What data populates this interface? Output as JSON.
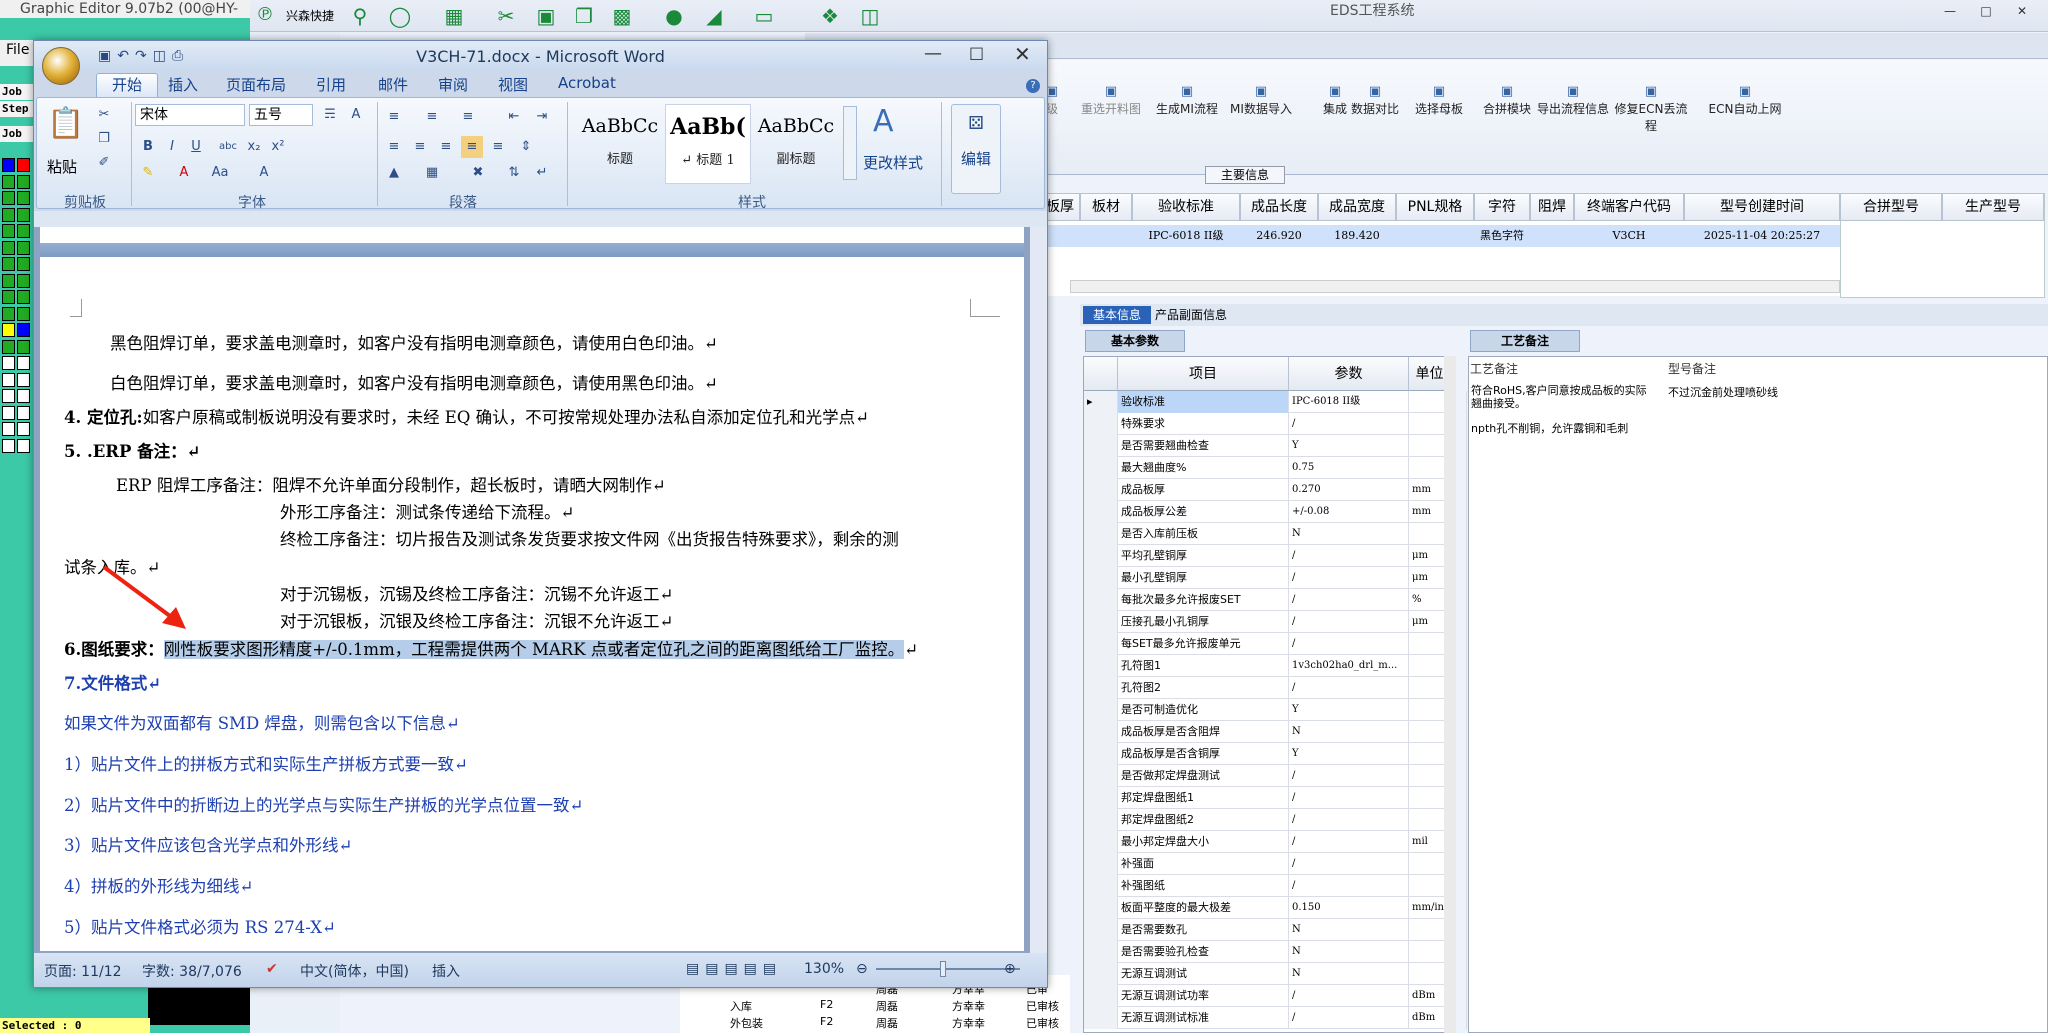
{
  "graphic_editor": {
    "title": "Graphic Editor 9.07b2 (00@HY-",
    "menu": "File",
    "labels": [
      "Job",
      "Step",
      "Job"
    ],
    "status": "Selected : 0"
  },
  "eds": {
    "title": "EDS工程系统",
    "quick_label": "兴森快捷",
    "toolbar_icons": [
      "search-icon",
      "lifebuoy-icon",
      "table-icon",
      "scissors-icon",
      "film-icon",
      "copy-icon",
      "grid-icon",
      "user-icon",
      "chart-icon",
      "monitor-icon",
      "windows-icon",
      "book-icon"
    ],
    "ribbon": [
      "级",
      "重选开料图",
      "生成MI流程",
      "MI数据导入",
      "集成",
      "数据对比",
      "选择母板",
      "合拼模块",
      "导出流程信息",
      "修复ECN丢流程",
      "ECN自动上网"
    ],
    "main_info_label": "主要信息",
    "grid_headers": [
      "板厚",
      "板材",
      "验收标准",
      "成品长度",
      "成品宽度",
      "PNL规格",
      "字符",
      "阻焊",
      "终端客户代码",
      "型号创建时间"
    ],
    "grid_row": [
      "",
      "",
      "IPC-6018 II级",
      "246.920",
      "189.420",
      "",
      "黑色字符",
      "",
      "V3CH",
      "2025-11-04 20:25:27"
    ],
    "side_headers": [
      "合拼型号",
      "生产型号"
    ],
    "tabs": {
      "basic": "基本信息",
      "product": "产品副面信息"
    },
    "sub_tabs": {
      "basic_params": "基本参数",
      "process_notes": "工艺备注"
    },
    "param_headers": [
      "项目",
      "参数",
      "单位"
    ],
    "params": [
      [
        "验收标准",
        "IPC-6018 II级",
        ""
      ],
      [
        "特殊要求",
        "/",
        ""
      ],
      [
        "是否需要翘曲检查",
        "Y",
        ""
      ],
      [
        "最大翘曲度%",
        "0.75",
        ""
      ],
      [
        "成品板厚",
        "0.270",
        "mm"
      ],
      [
        "成品板厚公差",
        "+/-0.08",
        "mm"
      ],
      [
        "是否入库前压板",
        "N",
        ""
      ],
      [
        "平均孔壁铜厚",
        "/",
        "μm"
      ],
      [
        "最小孔壁铜厚",
        "/",
        "μm"
      ],
      [
        "每批次最多允许报废SET",
        "/",
        "%"
      ],
      [
        "压接孔最小孔铜厚",
        "/",
        "μm"
      ],
      [
        "每SET最多允许报废单元",
        "/",
        ""
      ],
      [
        "孔符图1",
        "1v3ch02ha0_drl_m...",
        ""
      ],
      [
        "孔符图2",
        "/",
        ""
      ],
      [
        "是否可制造优化",
        "Y",
        ""
      ],
      [
        "成品板厚是否含阻焊",
        "N",
        ""
      ],
      [
        "成品板厚是否含铜厚",
        "Y",
        ""
      ],
      [
        "是否做邦定焊盘测试",
        "/",
        ""
      ],
      [
        "邦定焊盘图纸1",
        "/",
        ""
      ],
      [
        "邦定焊盘图纸2",
        "/",
        ""
      ],
      [
        "最小邦定焊盘大小",
        "/",
        "mil"
      ],
      [
        "补强面",
        "/",
        ""
      ],
      [
        "补强图纸",
        "/",
        ""
      ],
      [
        "板面平整度的最大极差",
        "0.150",
        "mm/inch"
      ],
      [
        "是否需要数孔",
        "N",
        ""
      ],
      [
        "是否需要验孔检查",
        "N",
        ""
      ],
      [
        "无源互调测试",
        "N",
        ""
      ],
      [
        "无源互调测试功率",
        "/",
        "dBm"
      ],
      [
        "无源互调测试标准",
        "/",
        "dBm"
      ]
    ],
    "param_flag": "Y",
    "process": {
      "col1": "工艺备注",
      "col2": "型号备注",
      "note1": "符合RoHS,客户同意按成品板的实际翘曲接受。",
      "note2": "npth孔不削铜，允许露铜和毛刺",
      "note3": "不过沉金前处理喷砂线"
    },
    "bottom_list": [
      [
        "",
        "",
        "周磊",
        "方幸幸",
        "已审"
      ],
      [
        "入库",
        "F2",
        "周磊",
        "方幸幸",
        "已审核"
      ],
      [
        "外包装",
        "F2",
        "周磊",
        "方幸幸",
        "已审核"
      ]
    ]
  },
  "word": {
    "title": "V3CH-71.docx - Microsoft Word",
    "tabs": [
      "开始",
      "插入",
      "页面布局",
      "引用",
      "邮件",
      "审阅",
      "视图",
      "Acrobat"
    ],
    "ribbon": {
      "paste": "粘贴",
      "font_name": "宋体",
      "font_size": "五号",
      "groups": [
        "剪贴板",
        "字体",
        "段落",
        "样式"
      ],
      "styles": [
        {
          "preview": "AaBbCc",
          "name": "标题"
        },
        {
          "preview": "AaBb(",
          "name": "↵ 标题 1"
        },
        {
          "preview": "AaBbCc",
          "name": "副标题"
        }
      ],
      "change_styles": "更改样式",
      "edit": "编辑"
    },
    "doc": {
      "l1": "黑色阻焊订单，要求盖电测章时，如客户没有指明电测章颜色，请使用白色印油。↵",
      "l2": "白色阻焊订单，要求盖电测章时，如客户没有指明电测章颜色，请使用黑色印油。↵",
      "l3a": "4.  定位孔:",
      "l3b": "如客户原稿或制板说明没有要求时，未经 EQ 确认，不可按常规处理办法私自添加定位孔和光学点↵",
      "l4": "5. .ERP 备注：↵",
      "l5": "ERP 阻焊工序备注：阻焊不允许单面分段制作，超长板时，请晒大网制作↵",
      "l6": "外形工序备注：测试条传递给下流程。↵",
      "l7": "终检工序备注：切片报告及测试条发货要求按文件网《出货报告特殊要求》，剩余的测",
      "l8": "试条入库。↵",
      "l9": "对于沉锡板，沉锡及终检工序备注：沉锡不允许返工↵",
      "l10": "对于沉银板，沉银及终检工序备注：沉银不允许返工↵",
      "l11a": "6.图纸要求：",
      "l11b": "刚性板要求图形精度+/-0.1mm，工程需提供两个 MARK 点或者定位孔之间的距离图纸给工厂监控。",
      "l11c": "↵",
      "l12": "7.文件格式↵",
      "l13": "如果文件为双面都有 SMD 焊盘，则需包含以下信息↵",
      "l14": "1）贴片文件上的拼板方式和实际生产拼板方式要一致↵",
      "l15": "2）贴片文件中的折断边上的光学点与实际生产拼板的光学点位置一致↵",
      "l16": "3）贴片文件应该包含光学点和外形线↵",
      "l17": "4）拼板的外形线为细线↵",
      "l18": "5）贴片文件格式必须为 RS 274-X↵"
    },
    "status": {
      "page": "页面: 11/12",
      "words": "字数: 38/7,076",
      "lang": "中文(简体，中国)",
      "mode": "插入",
      "zoom": "130%"
    }
  }
}
